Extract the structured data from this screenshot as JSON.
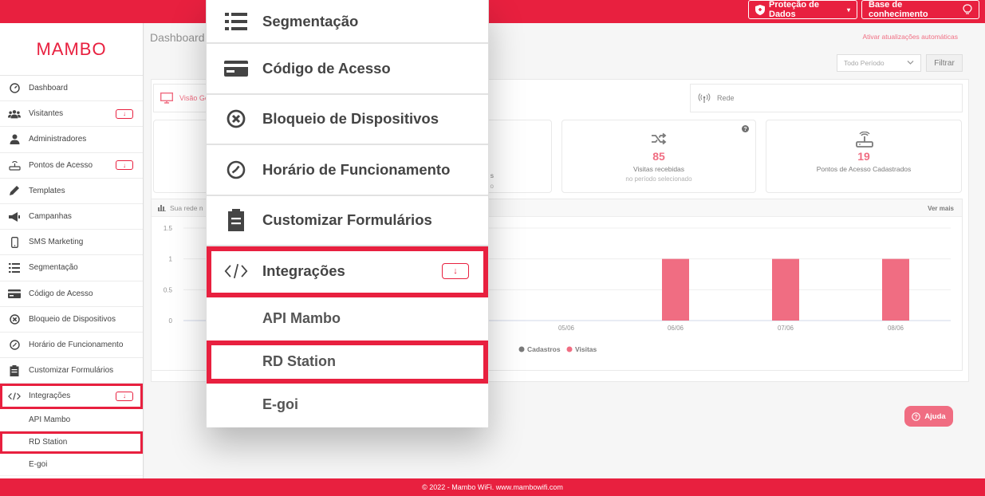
{
  "topbar": {
    "protection_label": "Proteção de Dados",
    "knowledge_label": "Base de conhecimento"
  },
  "logo_text": "MAMBO",
  "sidebar": {
    "items": [
      {
        "label": "Dashboard",
        "icon": "dashboard-icon"
      },
      {
        "label": "Visitantes",
        "icon": "users-icon",
        "badge": "↓"
      },
      {
        "label": "Administradores",
        "icon": "user-icon"
      },
      {
        "label": "Pontos de Acesso",
        "icon": "router-icon",
        "badge": "↓"
      },
      {
        "label": "Templates",
        "icon": "pencil-icon"
      },
      {
        "label": "Campanhas",
        "icon": "megaphone-icon"
      },
      {
        "label": "SMS Marketing",
        "icon": "mobile-icon"
      },
      {
        "label": "Segmentação",
        "icon": "list-icon"
      },
      {
        "label": "Código de Acesso",
        "icon": "card-icon"
      },
      {
        "label": "Bloqueio de Dispositivos",
        "icon": "block-icon"
      },
      {
        "label": "Horário de Funcionamento",
        "icon": "clock-icon"
      },
      {
        "label": "Customizar Formulários",
        "icon": "clipboard-icon"
      },
      {
        "label": "Integrações",
        "icon": "code-icon",
        "badge": "↓"
      }
    ],
    "subitems": [
      "API Mambo",
      "RD Station",
      "E-goi"
    ]
  },
  "main": {
    "title": "Dashboard",
    "auto_update": "Ativar atualizações automáticas",
    "period": "Todo Período",
    "filter": "Filtrar",
    "tabs": {
      "overview": "Visão Ge",
      "network": "Rede"
    },
    "card_left_frag": "s",
    "card_left_frag2": "o",
    "visits": {
      "value": "85",
      "label": "Visitas recebidas",
      "sub": "no período selecionado"
    },
    "access_points": {
      "value": "19",
      "label": "Pontos de Acesso Cadastrados"
    },
    "chart_title": "Sua rede n",
    "ver_mais": "Ver mais",
    "help": "Ajuda"
  },
  "chart_data": {
    "type": "bar",
    "x": [
      "05/06",
      "06/06",
      "07/06",
      "08/06"
    ],
    "series": [
      {
        "name": "Cadastros",
        "values": [
          0,
          0,
          0,
          0
        ],
        "color": "#333333"
      },
      {
        "name": "Visitas",
        "values": [
          0,
          1,
          1,
          1
        ],
        "color": "#e8203f"
      }
    ],
    "yticks": [
      "1.5",
      "1",
      "0.5",
      "0"
    ],
    "ylim": [
      0,
      1.5
    ]
  },
  "zoom": {
    "items": [
      {
        "label": "Segmentação",
        "icon": "list-icon"
      },
      {
        "label": "Código de Acesso",
        "icon": "card-icon"
      },
      {
        "label": "Bloqueio de Dispositivos",
        "icon": "block-icon"
      },
      {
        "label": "Horário de Funcionamento",
        "icon": "clock-icon"
      },
      {
        "label": "Customizar Formulários",
        "icon": "clipboard-icon"
      },
      {
        "label": "Integrações",
        "icon": "code-icon",
        "badge": "↓"
      }
    ],
    "subitems": [
      "API Mambo",
      "RD Station",
      "E-goi"
    ]
  },
  "footer": "© 2022 - Mambo WiFi. www.mambowifi.com"
}
